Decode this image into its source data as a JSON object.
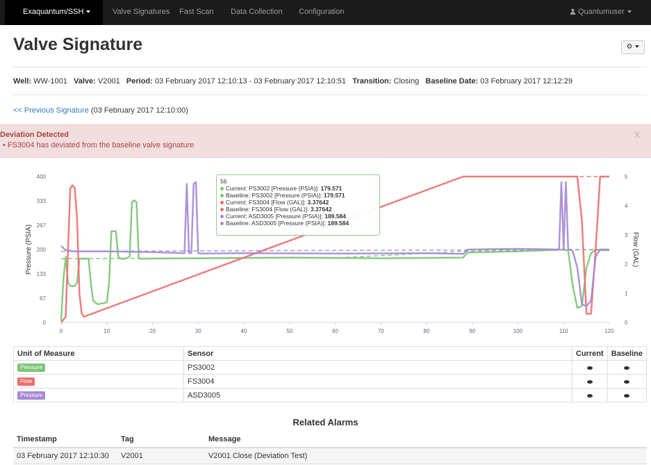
{
  "nav": {
    "brand": "Exaquantum/SSH",
    "items": [
      "Valve Signatures",
      "Fast Scan",
      "Data Collection",
      "Configuration"
    ],
    "user": "Quantumuser"
  },
  "page": {
    "title": "Valve Signature"
  },
  "info": {
    "well_label": "Well:",
    "well": "WW-1001",
    "valve_label": "Valve:",
    "valve": "V2001",
    "period_label": "Period:",
    "period": "03 February 2017 12:10:13 - 03 February 2017 12:10:51",
    "transition_label": "Transition:",
    "transition": "Closing",
    "baseline_label": "Baseline Date:",
    "baseline": "03 February 2017 12:12:29"
  },
  "prev": {
    "link": "<< Previous Signature",
    "date": "(03 February 2017 12:10:00)"
  },
  "alert": {
    "title": "Deviation Detected",
    "message": "• FS3004 has deviated from the baseline valve signature",
    "close": "X"
  },
  "chart_data": {
    "type": "line",
    "ylabel": "Pressure (PSIA)",
    "y2label": "Flow (GAL)",
    "x_ticks": [
      0,
      10,
      20,
      30,
      40,
      50,
      60,
      70,
      80,
      90,
      100,
      110,
      120
    ],
    "y_ticks": [
      0,
      67,
      133,
      200,
      267,
      333,
      400
    ],
    "y2_ticks": [
      0,
      1,
      2,
      3,
      4,
      5
    ],
    "xlim": [
      0,
      120
    ],
    "ylim": [
      0,
      400
    ],
    "y2lim": [
      0,
      5
    ],
    "colors": {
      "pressure": "#7cc576",
      "flow": "#ee6e6e",
      "asd": "#a48ad4"
    },
    "series": [
      {
        "name": "Current: PS3002 [Pressure (PSIA)]",
        "color": "#7cc576",
        "axis": "left",
        "x": [
          0,
          0.5,
          1,
          1.5,
          2,
          3,
          3.5,
          4,
          6,
          6.5,
          7,
          8,
          10,
          10.5,
          11,
          12,
          12.5,
          13,
          14,
          15,
          15.5,
          16,
          16.5,
          17,
          17.5,
          18,
          30,
          50,
          70,
          88,
          89,
          100,
          110,
          111,
          112,
          113,
          114,
          115,
          116,
          117,
          118,
          120
        ],
        "y": [
          5,
          120,
          180,
          110,
          100,
          100,
          110,
          175,
          175,
          110,
          60,
          50,
          55,
          110,
          250,
          250,
          180,
          175,
          175,
          180,
          330,
          335,
          330,
          175,
          175,
          175,
          176,
          178,
          176,
          178,
          192,
          195,
          200,
          197,
          100,
          40,
          45,
          150,
          190,
          200,
          198,
          198
        ]
      },
      {
        "name": "Baseline: PS3002 [Pressure (PSIA)]",
        "color": "#7cc576",
        "axis": "left",
        "dashed": true,
        "x": [
          0,
          20,
          60,
          88,
          120
        ],
        "y": [
          175,
          176,
          177,
          195,
          200
        ]
      },
      {
        "name": "Current: FS3004 [Flow (GAL)]",
        "color": "#ee6e6e",
        "axis": "right",
        "x": [
          0,
          1,
          1.5,
          2,
          2.5,
          3,
          3.5,
          4,
          4.5,
          5,
          88,
          89,
          112,
          113,
          114,
          115,
          116,
          117,
          118,
          119,
          120
        ],
        "y": [
          0,
          0.2,
          2.5,
          4.6,
          4.7,
          4.6,
          3.5,
          1.0,
          0.3,
          0.2,
          5,
          5,
          5,
          5,
          3.5,
          0.3,
          0.3,
          2.5,
          5,
          5,
          5
        ]
      },
      {
        "name": "Baseline: FS3004 [Flow (GAL)]",
        "color": "#ee6e6e",
        "axis": "right",
        "dashed": true,
        "x": [
          112,
          120
        ],
        "y": [
          5,
          5
        ]
      },
      {
        "name": "Current: ASD3005 [Pressure (PSIA)]",
        "color": "#a48ad4",
        "axis": "left",
        "x": [
          0,
          1,
          3,
          10,
          20,
          27,
          27.5,
          28,
          28.5,
          29,
          29.5,
          30,
          30.5,
          31,
          40,
          60,
          80,
          88,
          89,
          100,
          109,
          109.5,
          110,
          110.5,
          111,
          111.5,
          112,
          113,
          114,
          115,
          116,
          117,
          118,
          120
        ],
        "y": [
          210,
          198,
          195,
          195,
          193,
          190,
          380,
          190,
          190,
          380,
          385,
          190,
          189,
          189,
          190,
          189,
          190,
          188,
          200,
          202,
          200,
          385,
          200,
          385,
          200,
          200,
          195,
          150,
          50,
          45,
          60,
          180,
          200,
          200
        ]
      },
      {
        "name": "Baseline: ASD3005 [Pressure (PSIA)]",
        "color": "#a48ad4",
        "axis": "left",
        "dashed": true,
        "x": [
          0,
          120
        ],
        "y": [
          195,
          200
        ]
      }
    ],
    "tooltip": {
      "title": "56",
      "rows": [
        {
          "label": "Current: PS3002 [Pressure (PSIA)]:",
          "value": "179.571",
          "color": "#7cc576"
        },
        {
          "label": "Baseline: PS3002 [Pressure (PSIA)]:",
          "value": "179.571",
          "color": "#7cc576"
        },
        {
          "label": "Current: FS3004 [Flow (GAL)]:",
          "value": "3.37642",
          "color": "#ee6e6e"
        },
        {
          "label": "Baseline: FS3004 [Flow (GAL)]:",
          "value": "3.37642",
          "color": "#ee6e6e"
        },
        {
          "label": "Current: ASD3005 [Pressure (PSIA)]:",
          "value": "189.584",
          "color": "#a48ad4"
        },
        {
          "label": "Baseline: ASD3005 [Pressure (PSIA)]:",
          "value": "189.584",
          "color": "#a48ad4"
        }
      ]
    }
  },
  "sensors": {
    "headers": {
      "unit": "Unit of Measure",
      "sensor": "Sensor",
      "current": "Current",
      "baseline": "Baseline"
    },
    "rows": [
      {
        "unit": "Pressure",
        "color": "#7cc576",
        "sensor": "PS3002"
      },
      {
        "unit": "Flow",
        "color": "#ee6e6e",
        "sensor": "FS3004"
      },
      {
        "unit": "Pressure",
        "color": "#a48ad4",
        "sensor": "ASD3005"
      }
    ]
  },
  "alarms": {
    "title": "Related Alarms",
    "headers": {
      "timestamp": "Timestamp",
      "tag": "Tag",
      "message": "Message"
    },
    "rows": [
      {
        "timestamp": "03 February 2017 12:10:30",
        "tag": "V2001",
        "message": "V2001 Close (Deviation Test)"
      }
    ]
  }
}
